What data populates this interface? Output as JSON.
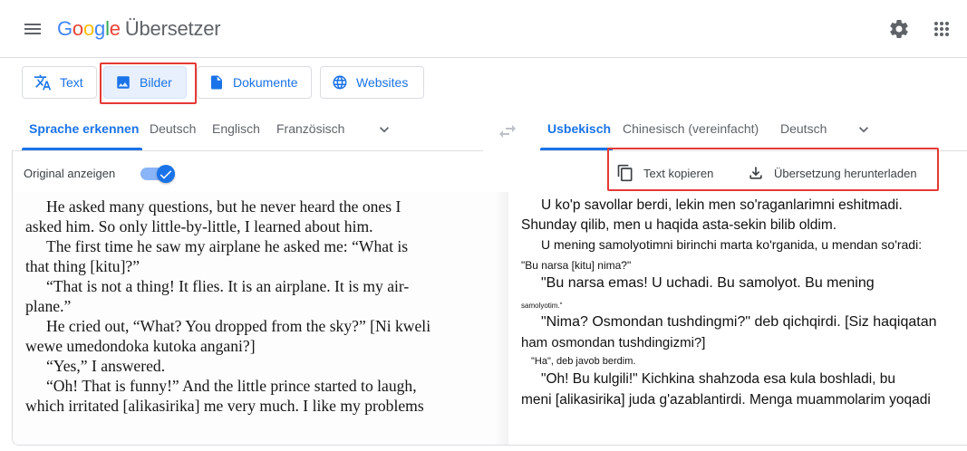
{
  "header": {
    "logo_letters": [
      "G",
      "o",
      "o",
      "g",
      "l",
      "e"
    ],
    "product_name": "Übersetzer",
    "menu_icon": "hamburger-menu-icon",
    "settings_icon": "gear-icon",
    "apps_icon": "apps-grid-icon"
  },
  "mode_tabs": [
    {
      "label": "Text",
      "icon": "translate-icon",
      "active": false
    },
    {
      "label": "Bilder",
      "icon": "image-icon",
      "active": true
    },
    {
      "label": "Dokumente",
      "icon": "document-icon",
      "active": false
    },
    {
      "label": "Websites",
      "icon": "globe-icon",
      "active": false
    }
  ],
  "source_languages": {
    "items": [
      "Sprache erkennen",
      "Deutsch",
      "Englisch",
      "Französisch"
    ],
    "selected": "Sprache erkennen"
  },
  "target_languages": {
    "items": [
      "Usbekisch",
      "Chinesisch (vereinfacht)",
      "Deutsch"
    ],
    "selected": "Usbekisch"
  },
  "source_panel": {
    "show_original_label": "Original anzeigen",
    "show_original_on": true
  },
  "target_panel": {
    "copy_label": "Text kopieren",
    "download_label": "Übersetzung herunterladen"
  },
  "original_image_text": [
    "He asked many questions, but he never heard the ones I",
    "asked him. So only little-by-little, I learned about him.",
    "The first time he saw my airplane he asked me: “What is",
    "that thing [kitu]?”",
    "“That is not a thing! It flies. It is an airplane. It is my air-",
    "plane.”",
    "He cried out, “What? You dropped from the sky?” [Ni kweli",
    "wewe umedondoka kutoka angani?]",
    "“Yes,” I answered.",
    "“Oh! That is funny!” And the little prince started to laugh,",
    "which irritated [alikasirika] me very much. I like my problems"
  ],
  "translated_image_text": [
    "U ko'p savollar berdi, lekin men so'raganlarimni eshitmadi.",
    "Shunday qilib, men u haqida asta-sekin bilib oldim.",
    "U mening samolyotimni birinchi marta ko'rganida, u mendan so'radi:",
    "\"Bu narsa [kitu] nima?\"",
    "\"Bu narsa emas! U uchadi. Bu samolyot. Bu mening",
    "samolyotim.\"",
    "\"Nima? Osmondan tushdingmi?\" deb qichqirdi. [Siz haqiqatan",
    "ham osmondan tushdingizmi?]",
    "\"Ha\", deb javob berdim.",
    "\"Oh! Bu kulgili!\" Kichkina shahzoda esa kula boshladi, bu",
    "meni [alikasirika] juda g'azablantirdi. Menga muammolarim yoqadi"
  ],
  "colors": {
    "accent": "#1a73e8",
    "highlight": "#e53935",
    "active_tab_bg": "#e8f0fe"
  }
}
